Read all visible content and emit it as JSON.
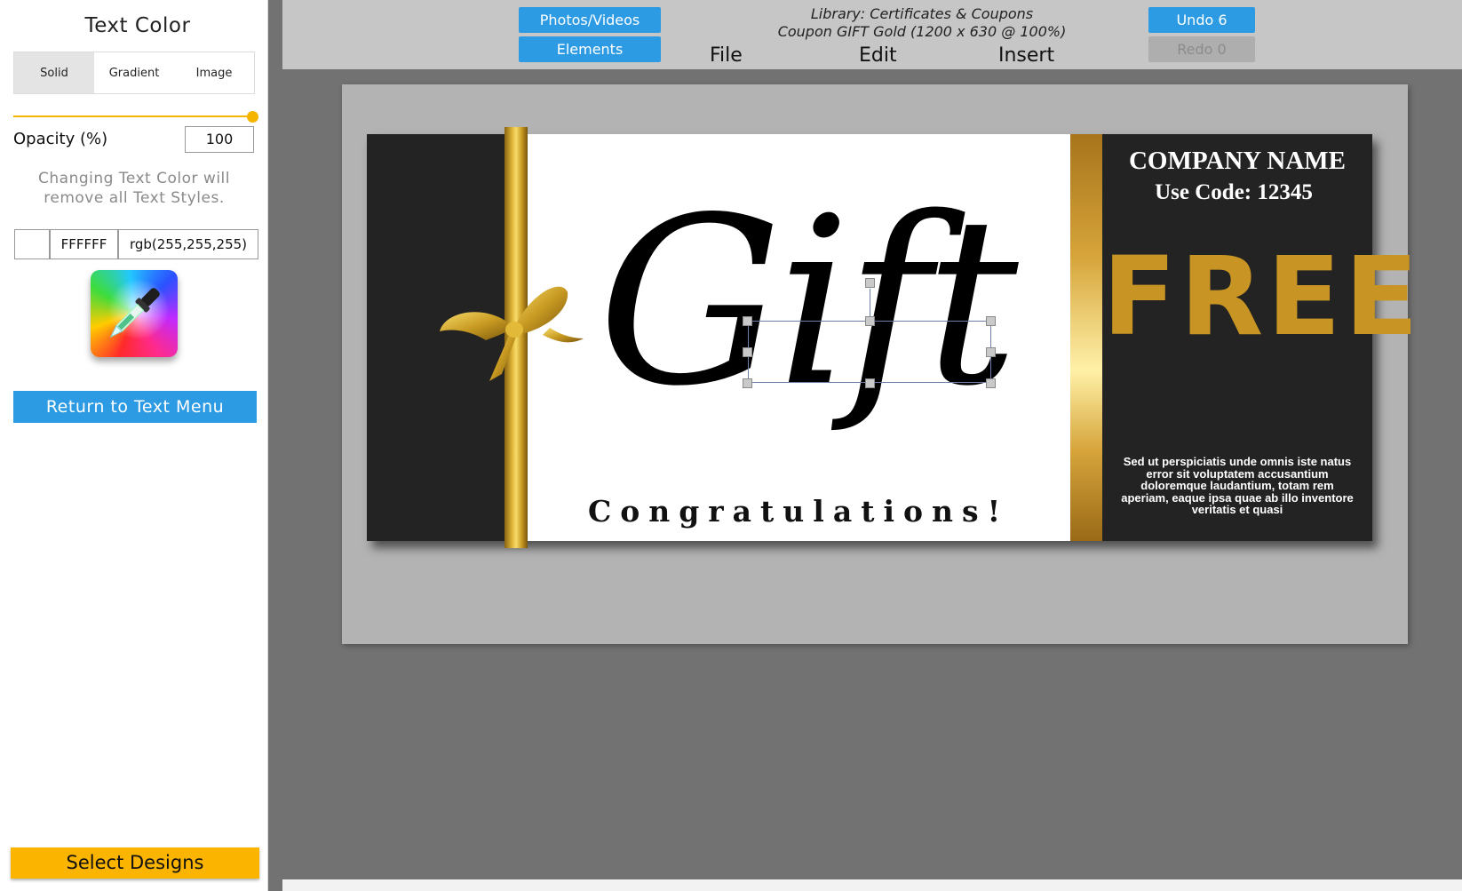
{
  "panel": {
    "title": "Text Color",
    "tabs": [
      "Solid",
      "Gradient",
      "Image"
    ],
    "active_tab": "Solid",
    "opacity_label": "Opacity (%)",
    "opacity_value": "100",
    "note": "Changing Text Color will remove all Text Styles.",
    "hex_value": "FFFFFF",
    "rgb_value": "rgb(255,255,255)",
    "swatch_color": "#ffffff",
    "picker_icon": "color-picker-eyedropper-icon",
    "return_button": "Return to Text Menu",
    "select_designs_button": "Select Designs"
  },
  "toolbar": {
    "photos_videos": "Photos/Videos",
    "elements": "Elements",
    "doc_title_line1": "Library: Certificates & Coupons",
    "doc_title_line2": "Coupon GIFT Gold (1200 x 630 @ 100%)",
    "menu": [
      "File",
      "Edit",
      "Insert"
    ],
    "undo": "Undo 6",
    "redo": "Redo 0"
  },
  "coupon": {
    "gift": "Gift",
    "congratulations": "Congratulations!",
    "company_name": "COMPANY NAME",
    "use_code": "Use Code: 12345",
    "free": "FREE",
    "body_text": "Sed ut perspiciatis unde omnis iste natus error sit voluptatem accusantium doloremque laudantium, totam rem aperiam, eaque ipsa quae ab illo inventore veritatis et quasi"
  },
  "colors": {
    "accent_blue": "#2d9be3",
    "accent_yellow": "#fbb400",
    "gold": "#c89524",
    "dark": "#232323"
  }
}
